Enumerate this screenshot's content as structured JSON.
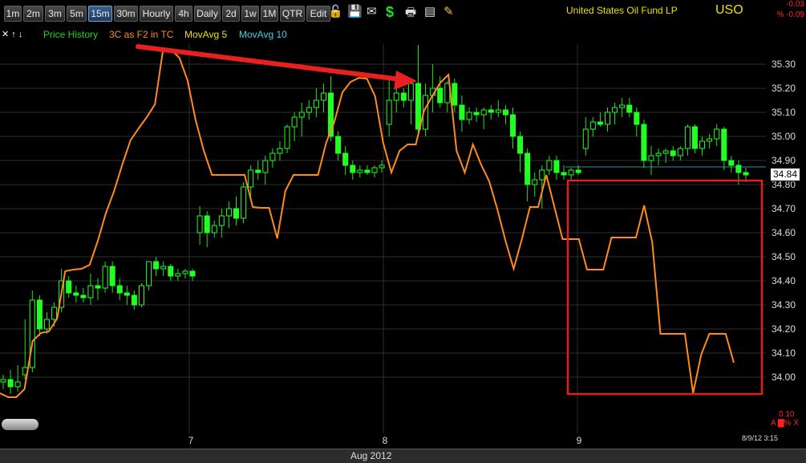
{
  "toolbar": {
    "timeframes": [
      "1m",
      "2m",
      "3m",
      "5m",
      "15m",
      "30m",
      "Hourly",
      "4h",
      "Daily",
      "2d",
      "1w",
      "1M",
      "QTR",
      "Edit"
    ],
    "active": "15m",
    "icons": [
      "lock-icon",
      "save-icon",
      "email-icon",
      "dollar-icon",
      "print-icon",
      "quote-card-icon",
      "pencil-icon"
    ]
  },
  "symbol_name": "United States Oil Fund LP",
  "symbol": "USO",
  "change": "-0.03",
  "change_pct": "% -0.09",
  "legend": {
    "arrows": "✕ ↑ ↓",
    "items": [
      {
        "label": "Price History",
        "color": "#22d022"
      },
      {
        "label": "3C as F2 in TC",
        "color": "#ff8c1a"
      },
      {
        "label": "MovAvg 5",
        "color": "#f0e000"
      },
      {
        "label": "MovAvg 10",
        "color": "#3ad0f0"
      }
    ]
  },
  "price_tag": "34.84",
  "indicator": {
    "value": "0.10",
    "control": "A ▇% X"
  },
  "timestamp": "8/9/12 3:15",
  "month_label": "Aug 2012",
  "colors": {
    "up": "#22ff22",
    "down": "#22ff22",
    "line3c": "#ff8c1a",
    "grid": "#333333",
    "box": "#e02020",
    "arrow": "#e82020"
  },
  "chart_data": {
    "type": "candlestick",
    "y_axis": {
      "min": 33.9,
      "max": 35.45,
      "ticks": [
        34.0,
        34.1,
        34.2,
        34.3,
        34.4,
        34.5,
        34.6,
        34.7,
        34.8,
        34.9,
        35.0,
        35.1,
        35.2,
        35.3
      ]
    },
    "x_ticks": [
      "7",
      "8",
      "9"
    ],
    "candles": [
      [
        33.98,
        34.01,
        33.95,
        33.99
      ],
      [
        33.99,
        34.03,
        33.93,
        33.96
      ],
      [
        33.96,
        34.05,
        33.94,
        33.98
      ],
      [
        34.01,
        34.24,
        33.99,
        34.04
      ],
      [
        34.04,
        34.36,
        34.02,
        34.32
      ],
      [
        34.32,
        34.34,
        34.17,
        34.2
      ],
      [
        34.2,
        34.27,
        34.18,
        34.24
      ],
      [
        34.24,
        34.31,
        34.21,
        34.29
      ],
      [
        34.29,
        34.45,
        34.27,
        34.4
      ],
      [
        34.4,
        34.42,
        34.33,
        34.35
      ],
      [
        34.35,
        34.38,
        34.31,
        34.34
      ],
      [
        34.34,
        34.37,
        34.31,
        34.33
      ],
      [
        34.33,
        34.43,
        34.3,
        34.38
      ],
      [
        34.38,
        34.41,
        34.32,
        34.37
      ],
      [
        34.37,
        34.48,
        34.35,
        34.46
      ],
      [
        34.46,
        34.48,
        34.35,
        34.38
      ],
      [
        34.38,
        34.41,
        34.32,
        34.35
      ],
      [
        34.35,
        34.38,
        34.3,
        34.34
      ],
      [
        34.34,
        34.36,
        34.28,
        34.3
      ],
      [
        34.3,
        34.39,
        34.29,
        34.38
      ],
      [
        34.38,
        34.48,
        34.36,
        34.48
      ],
      [
        34.48,
        34.5,
        34.42,
        34.45
      ],
      [
        34.45,
        34.48,
        34.42,
        34.46
      ],
      [
        34.46,
        34.47,
        34.4,
        34.42
      ],
      [
        34.42,
        34.45,
        34.4,
        34.43
      ],
      [
        34.43,
        34.45,
        34.41,
        34.44
      ],
      [
        34.44,
        34.45,
        34.4,
        34.42
      ],
      [
        34.6,
        34.71,
        34.55,
        34.67
      ],
      [
        34.67,
        34.69,
        34.54,
        34.6
      ],
      [
        34.6,
        34.65,
        34.58,
        34.63
      ],
      [
        34.63,
        34.7,
        34.58,
        34.67
      ],
      [
        34.67,
        34.73,
        34.62,
        34.7
      ],
      [
        34.7,
        34.75,
        34.63,
        34.66
      ],
      [
        34.66,
        34.81,
        34.64,
        34.79
      ],
      [
        34.79,
        34.88,
        34.75,
        34.86
      ],
      [
        34.86,
        34.9,
        34.82,
        34.85
      ],
      [
        34.85,
        34.92,
        34.8,
        34.9
      ],
      [
        34.9,
        34.95,
        34.87,
        34.93
      ],
      [
        34.93,
        34.98,
        34.9,
        34.95
      ],
      [
        34.95,
        35.05,
        34.93,
        35.04
      ],
      [
        35.04,
        35.1,
        34.98,
        35.08
      ],
      [
        35.08,
        35.14,
        35.0,
        35.1
      ],
      [
        35.1,
        35.15,
        35.07,
        35.12
      ],
      [
        35.12,
        35.2,
        35.08,
        35.15
      ],
      [
        35.15,
        35.22,
        35.1,
        35.18
      ],
      [
        35.18,
        35.25,
        34.98,
        35.0
      ],
      [
        35.0,
        35.02,
        34.9,
        34.93
      ],
      [
        34.93,
        34.96,
        34.84,
        34.88
      ],
      [
        34.88,
        34.9,
        34.82,
        34.85
      ],
      [
        34.85,
        34.88,
        34.83,
        34.86
      ],
      [
        34.86,
        34.88,
        34.84,
        34.85
      ],
      [
        34.85,
        34.88,
        34.83,
        34.87
      ],
      [
        34.87,
        34.9,
        34.85,
        34.88
      ],
      [
        35.05,
        35.25,
        35.0,
        35.15
      ],
      [
        35.15,
        35.22,
        35.1,
        35.18
      ],
      [
        35.18,
        35.2,
        35.12,
        35.15
      ],
      [
        35.15,
        35.24,
        35.05,
        35.22
      ],
      [
        35.22,
        35.38,
        35.0,
        35.03
      ],
      [
        35.03,
        35.22,
        35.0,
        35.17
      ],
      [
        35.17,
        35.3,
        35.1,
        35.2
      ],
      [
        35.2,
        35.25,
        35.12,
        35.14
      ],
      [
        35.14,
        35.23,
        35.1,
        35.22
      ],
      [
        35.22,
        35.24,
        35.1,
        35.13
      ],
      [
        35.13,
        35.17,
        35.02,
        35.07
      ],
      [
        35.07,
        35.12,
        35.05,
        35.1
      ],
      [
        35.1,
        35.12,
        35.06,
        35.09
      ],
      [
        35.09,
        35.12,
        35.03,
        35.11
      ],
      [
        35.11,
        35.13,
        35.07,
        35.1
      ],
      [
        35.1,
        35.15,
        35.08,
        35.11
      ],
      [
        35.11,
        35.13,
        35.05,
        35.09
      ],
      [
        35.09,
        35.12,
        34.95,
        35.0
      ],
      [
        35.0,
        35.02,
        34.85,
        34.93
      ],
      [
        34.93,
        34.95,
        34.73,
        34.8
      ],
      [
        34.8,
        34.85,
        34.75,
        34.82
      ],
      [
        34.82,
        34.88,
        34.7,
        34.86
      ],
      [
        34.86,
        34.92,
        34.84,
        34.9
      ],
      [
        34.9,
        34.92,
        34.82,
        34.85
      ],
      [
        34.85,
        34.88,
        34.82,
        34.84
      ],
      [
        34.84,
        34.87,
        34.82,
        34.86
      ],
      [
        34.86,
        34.88,
        34.84,
        34.85
      ],
      [
        34.95,
        35.08,
        34.92,
        35.03
      ],
      [
        35.03,
        35.08,
        35.0,
        35.06
      ],
      [
        35.06,
        35.1,
        35.04,
        35.05
      ],
      [
        35.05,
        35.12,
        35.02,
        35.1
      ],
      [
        35.1,
        35.14,
        35.05,
        35.12
      ],
      [
        35.12,
        35.16,
        35.08,
        35.13
      ],
      [
        35.13,
        35.16,
        35.08,
        35.1
      ],
      [
        35.1,
        35.12,
        35.0,
        35.05
      ],
      [
        35.05,
        35.07,
        34.87,
        34.9
      ],
      [
        34.9,
        34.96,
        34.84,
        34.92
      ],
      [
        34.92,
        34.95,
        34.88,
        34.93
      ],
      [
        34.93,
        34.95,
        34.89,
        34.94
      ],
      [
        34.94,
        34.96,
        34.9,
        34.92
      ],
      [
        34.92,
        34.96,
        34.9,
        34.95
      ],
      [
        34.95,
        35.05,
        34.92,
        35.04
      ],
      [
        35.04,
        35.05,
        34.93,
        34.95
      ],
      [
        34.95,
        35.0,
        34.92,
        34.98
      ],
      [
        34.98,
        35.01,
        34.95,
        34.99
      ],
      [
        34.99,
        35.05,
        34.96,
        35.03
      ],
      [
        35.03,
        35.04,
        34.86,
        34.9
      ],
      [
        34.9,
        34.92,
        34.85,
        34.88
      ],
      [
        34.88,
        34.9,
        34.8,
        34.85
      ],
      [
        34.85,
        34.87,
        34.81,
        34.84
      ]
    ],
    "indicator_3c": [
      490,
      495,
      495,
      485,
      425,
      415,
      413,
      397,
      338,
      336,
      335,
      330,
      300,
      265,
      238,
      205,
      175,
      160,
      146,
      130,
      62,
      62,
      72,
      100,
      150,
      188,
      218,
      218,
      218,
      218,
      218,
      258,
      259,
      259,
      297,
      238,
      218,
      218,
      218,
      218,
      178,
      152,
      115,
      102,
      97,
      98,
      120,
      178,
      215,
      188,
      180,
      180,
      138,
      120,
      103,
      93,
      188,
      215,
      180,
      205,
      226,
      261,
      300,
      335,
      298,
      258,
      258,
      218,
      258,
      298,
      298,
      298,
      336,
      336,
      336,
      296,
      296,
      296,
      296,
      256,
      302,
      416,
      416,
      416,
      416,
      490,
      442,
      416,
      416,
      416,
      452
    ]
  }
}
